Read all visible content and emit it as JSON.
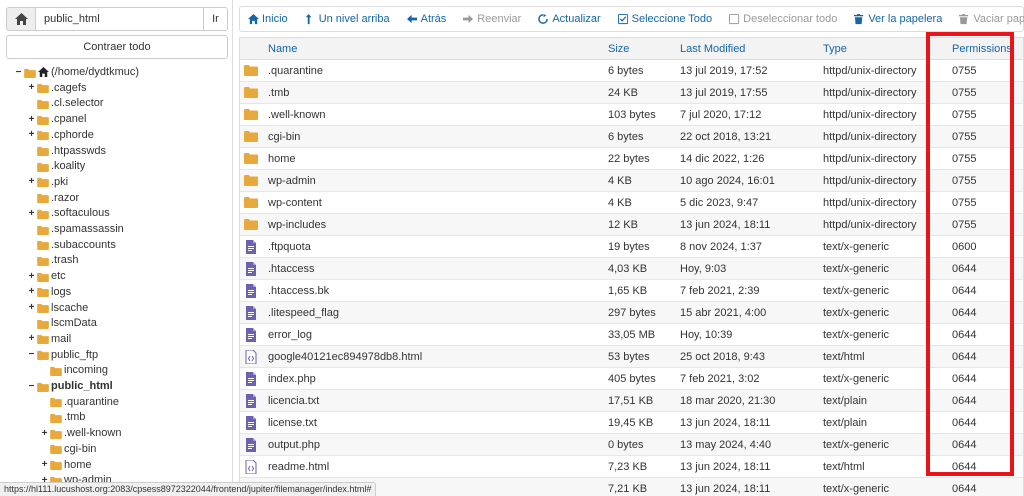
{
  "path_bar": {
    "value": "public_html",
    "go_label": "Ir"
  },
  "collapse_label": "Contraer todo",
  "tree": [
    {
      "label": "(/home/dydtkmuc)",
      "toggle": "−",
      "home": true,
      "level": 0
    },
    {
      "label": ".cagefs",
      "toggle": "+",
      "level": 1
    },
    {
      "label": ".cl.selector",
      "toggle": "",
      "level": 1
    },
    {
      "label": ".cpanel",
      "toggle": "+",
      "level": 1
    },
    {
      "label": ".cphorde",
      "toggle": "+",
      "level": 1
    },
    {
      "label": ".htpasswds",
      "toggle": "",
      "level": 1
    },
    {
      "label": ".koality",
      "toggle": "",
      "level": 1
    },
    {
      "label": ".pki",
      "toggle": "+",
      "level": 1
    },
    {
      "label": ".razor",
      "toggle": "",
      "level": 1
    },
    {
      "label": ".softaculous",
      "toggle": "+",
      "level": 1
    },
    {
      "label": ".spamassassin",
      "toggle": "",
      "level": 1
    },
    {
      "label": ".subaccounts",
      "toggle": "",
      "level": 1
    },
    {
      "label": ".trash",
      "toggle": "",
      "level": 1
    },
    {
      "label": "etc",
      "toggle": "+",
      "level": 1
    },
    {
      "label": "logs",
      "toggle": "+",
      "level": 1
    },
    {
      "label": "lscache",
      "toggle": "+",
      "level": 1
    },
    {
      "label": "lscmData",
      "toggle": "",
      "level": 1
    },
    {
      "label": "mail",
      "toggle": "+",
      "level": 1
    },
    {
      "label": "public_ftp",
      "toggle": "−",
      "level": 1
    },
    {
      "label": "incoming",
      "toggle": "",
      "level": 2
    },
    {
      "label": "public_html",
      "toggle": "−",
      "level": 1,
      "bold": true
    },
    {
      "label": ".quarantine",
      "toggle": "",
      "level": 2
    },
    {
      "label": ".tmb",
      "toggle": "",
      "level": 2
    },
    {
      "label": ".well-known",
      "toggle": "+",
      "level": 2
    },
    {
      "label": "cgi-bin",
      "toggle": "",
      "level": 2
    },
    {
      "label": "home",
      "toggle": "+",
      "level": 2
    },
    {
      "label": "wp-admin",
      "toggle": "+",
      "level": 2
    }
  ],
  "toolbar": [
    {
      "label": "Inicio",
      "icon": "home-icon",
      "enabled": true
    },
    {
      "label": "Un nivel arriba",
      "icon": "level-up-icon",
      "enabled": true
    },
    {
      "label": "Atrás",
      "icon": "arrow-left-icon",
      "enabled": true
    },
    {
      "label": "Reenviar",
      "icon": "arrow-right-icon",
      "enabled": false
    },
    {
      "label": "Actualizar",
      "icon": "refresh-icon",
      "enabled": true
    },
    {
      "label": "Seleccione Todo",
      "icon": "checkbox-checked-icon",
      "enabled": true
    },
    {
      "label": "Deseleccionar todo",
      "icon": "checkbox-empty-icon",
      "enabled": false
    },
    {
      "label": "Ver la papelera",
      "icon": "trash-icon",
      "enabled": true
    },
    {
      "label": "Vaciar papelera",
      "icon": "trash-icon",
      "enabled": false
    }
  ],
  "columns": {
    "name": "Name",
    "size": "Size",
    "modified": "Last Modified",
    "type": "Type",
    "permissions": "Permissions"
  },
  "files": [
    {
      "icon": "folder",
      "name": ".quarantine",
      "size": "6 bytes",
      "modified": "13 jul 2019, 17:52",
      "type": "httpd/unix-directory",
      "perm": "0755"
    },
    {
      "icon": "folder",
      "name": ".tmb",
      "size": "24 KB",
      "modified": "13 jul 2019, 17:55",
      "type": "httpd/unix-directory",
      "perm": "0755"
    },
    {
      "icon": "folder",
      "name": ".well-known",
      "size": "103 bytes",
      "modified": "7 jul 2020, 17:12",
      "type": "httpd/unix-directory",
      "perm": "0755"
    },
    {
      "icon": "folder",
      "name": "cgi-bin",
      "size": "6 bytes",
      "modified": "22 oct 2018, 13:21",
      "type": "httpd/unix-directory",
      "perm": "0755"
    },
    {
      "icon": "folder",
      "name": "home",
      "size": "22 bytes",
      "modified": "14 dic 2022, 1:26",
      "type": "httpd/unix-directory",
      "perm": "0755"
    },
    {
      "icon": "folder",
      "name": "wp-admin",
      "size": "4 KB",
      "modified": "10 ago 2024, 16:01",
      "type": "httpd/unix-directory",
      "perm": "0755"
    },
    {
      "icon": "folder",
      "name": "wp-content",
      "size": "4 KB",
      "modified": "5 dic 2023, 9:47",
      "type": "httpd/unix-directory",
      "perm": "0755"
    },
    {
      "icon": "folder",
      "name": "wp-includes",
      "size": "12 KB",
      "modified": "13 jun 2024, 18:11",
      "type": "httpd/unix-directory",
      "perm": "0755"
    },
    {
      "icon": "file",
      "name": ".ftpquota",
      "size": "19 bytes",
      "modified": "8 nov 2024, 1:37",
      "type": "text/x-generic",
      "perm": "0600"
    },
    {
      "icon": "file",
      "name": ".htaccess",
      "size": "4,03 KB",
      "modified": "Hoy, 9:03",
      "type": "text/x-generic",
      "perm": "0644"
    },
    {
      "icon": "file",
      "name": ".htaccess.bk",
      "size": "1,65 KB",
      "modified": "7 feb 2021, 2:39",
      "type": "text/x-generic",
      "perm": "0644"
    },
    {
      "icon": "file",
      "name": ".litespeed_flag",
      "size": "297 bytes",
      "modified": "15 abr 2021, 4:00",
      "type": "text/x-generic",
      "perm": "0644"
    },
    {
      "icon": "file",
      "name": "error_log",
      "size": "33,05 MB",
      "modified": "Hoy, 10:39",
      "type": "text/x-generic",
      "perm": "0644"
    },
    {
      "icon": "code",
      "name": "google40121ec894978db8.html",
      "size": "53 bytes",
      "modified": "25 oct 2018, 9:43",
      "type": "text/html",
      "perm": "0644"
    },
    {
      "icon": "file",
      "name": "index.php",
      "size": "405 bytes",
      "modified": "7 feb 2021, 3:02",
      "type": "text/x-generic",
      "perm": "0644"
    },
    {
      "icon": "file",
      "name": "licencia.txt",
      "size": "17,51 KB",
      "modified": "18 mar 2020, 21:30",
      "type": "text/plain",
      "perm": "0644"
    },
    {
      "icon": "file",
      "name": "license.txt",
      "size": "19,45 KB",
      "modified": "13 jun 2024, 18:11",
      "type": "text/plain",
      "perm": "0644"
    },
    {
      "icon": "file",
      "name": "output.php",
      "size": "0 bytes",
      "modified": "13 may 2024, 4:40",
      "type": "text/x-generic",
      "perm": "0644"
    },
    {
      "icon": "code",
      "name": "readme.html",
      "size": "7,23 KB",
      "modified": "13 jun 2024, 18:11",
      "type": "text/html",
      "perm": "0644"
    },
    {
      "icon": "file",
      "name": "",
      "size": "7,21 KB",
      "modified": "13 jun 2024, 18:11",
      "type": "text/x-generic",
      "perm": "0644"
    }
  ],
  "status_url": "https://hl111.lucushost.org:2083/cpsess8972322044/frontend/jupiter/filemanager/index.html#",
  "colors": {
    "link": "#1565a8",
    "folder": "#e8a93c",
    "file": "#6e5fb0",
    "highlight": "#e8141a"
  }
}
